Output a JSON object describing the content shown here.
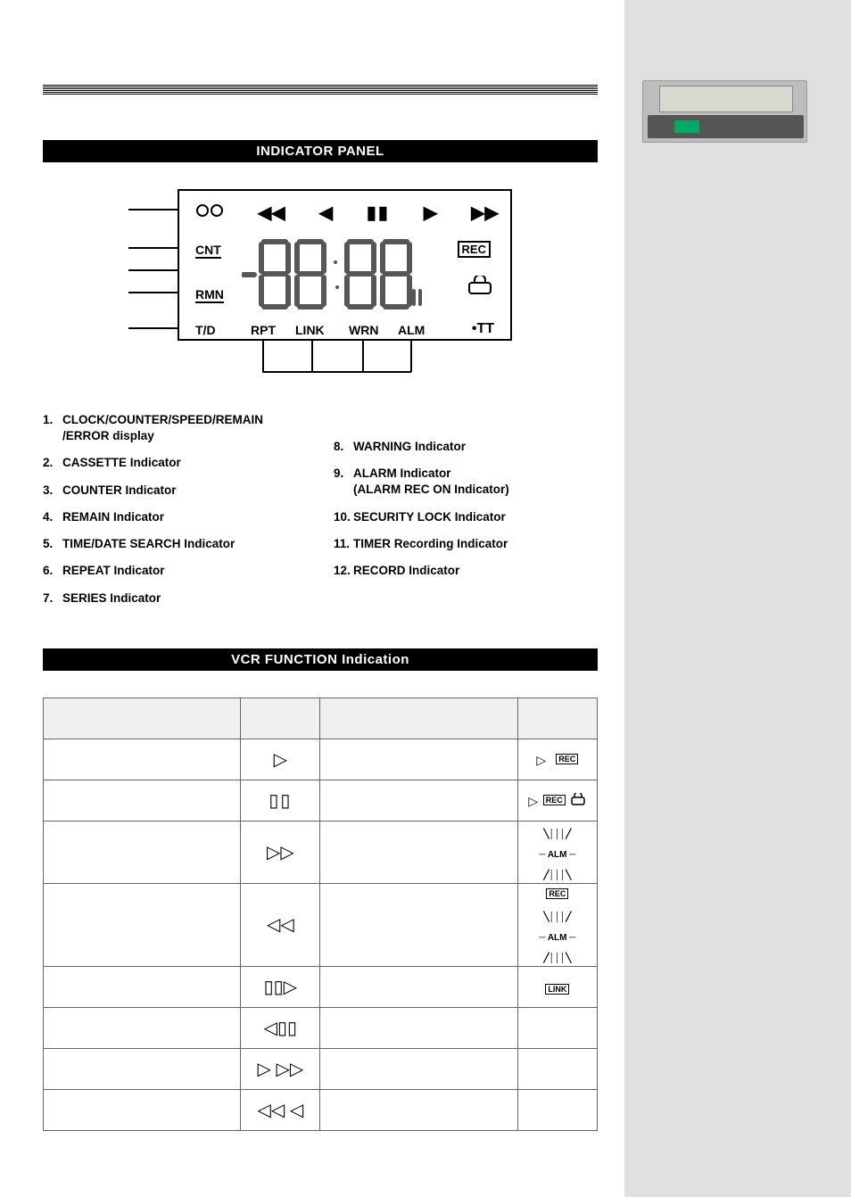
{
  "section1_title": "INDICATOR PANEL",
  "section2_title": "VCR FUNCTION Indication",
  "panel": {
    "cnt": "CNT",
    "rmn": "RMN",
    "td": "T/D",
    "rpt": "RPT",
    "link": "LINK",
    "wrn": "WRN",
    "alm": "ALM",
    "rec": "REC",
    "tt": "•TT",
    "display": "-88:88"
  },
  "list_left": [
    {
      "n": "1.",
      "t": "CLOCK/COUNTER/SPEED/REMAIN",
      "sub": "/ERROR display"
    },
    {
      "n": "2.",
      "t": "CASSETTE Indicator"
    },
    {
      "n": "3.",
      "t": "COUNTER Indicator"
    },
    {
      "n": "4.",
      "t": "REMAIN Indicator"
    },
    {
      "n": "5.",
      "t": "TIME/DATE SEARCH Indicator"
    },
    {
      "n": "6.",
      "t": "REPEAT Indicator"
    },
    {
      "n": "7.",
      "t": "SERIES Indicator"
    }
  ],
  "list_right": [
    {
      "n": "8.",
      "t": "WARNING Indicator"
    },
    {
      "n": "9.",
      "t": "ALARM Indicator",
      "sub": "(ALARM REC ON Indicator)"
    },
    {
      "n": "10.",
      "t": "SECURITY LOCK Indicator"
    },
    {
      "n": "11.",
      "t": "TIMER Recording Indicator"
    },
    {
      "n": "12.",
      "t": "RECORD Indicator"
    }
  ],
  "table_header": {
    "c1": "",
    "c2": "",
    "c3": "",
    "c4": ""
  },
  "rows": [
    {
      "l": "",
      "icon": "play"
    },
    {
      "l": "",
      "icon": "pause"
    },
    {
      "l": "",
      "icon": "ff"
    },
    {
      "l": "",
      "icon": "rew"
    },
    {
      "l": "",
      "icon": "slowf"
    },
    {
      "l": "",
      "icon": "slowr"
    },
    {
      "l": "",
      "icon": "searchf"
    },
    {
      "l": "",
      "icon": "searchr"
    }
  ],
  "rows_right": [
    {
      "l": "",
      "icon": "rec"
    },
    {
      "l": "",
      "icon": "reclock"
    },
    {
      "l": "",
      "icon": "alm"
    },
    {
      "l": "",
      "icon": "almrec"
    },
    {
      "l": "",
      "icon": "link"
    }
  ]
}
